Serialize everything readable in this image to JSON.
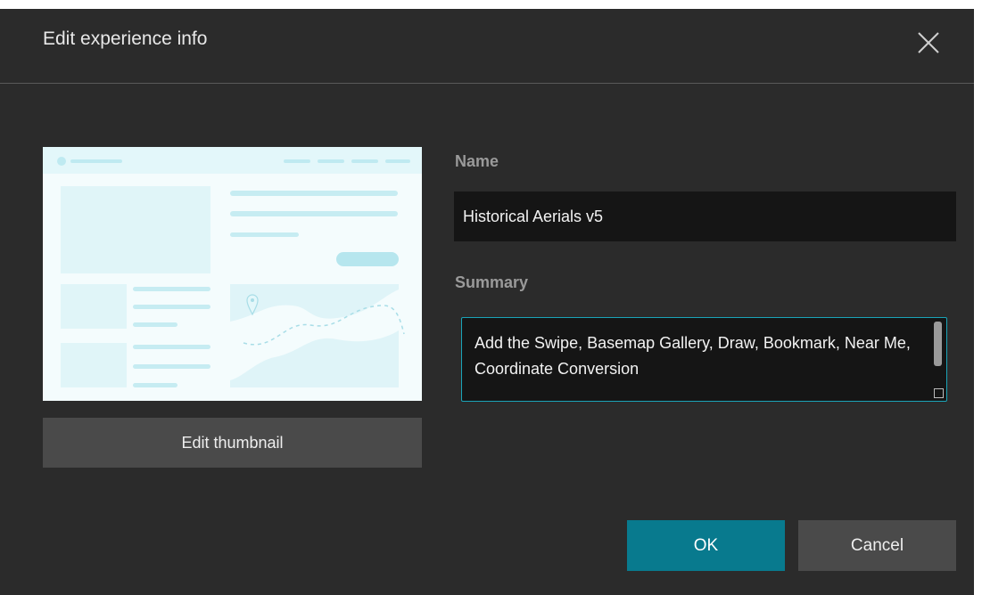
{
  "dialog": {
    "title": "Edit experience info",
    "close_icon": "close-icon"
  },
  "thumbnail": {
    "edit_label": "Edit thumbnail",
    "accent_color": "#c9eef4",
    "light_color": "#e4f7fa"
  },
  "form": {
    "name_label": "Name",
    "name_value": "Historical Aerials v5",
    "summary_label": "Summary",
    "summary_value": "Add the Swipe, Basemap Gallery, Draw, Bookmark, Near Me, Coordinate Conversion"
  },
  "footer": {
    "ok_label": "OK",
    "cancel_label": "Cancel"
  },
  "colors": {
    "dialog_bg": "#2b2b2b",
    "primary_button": "#087a8e",
    "focus_border": "#1aa4b8"
  }
}
